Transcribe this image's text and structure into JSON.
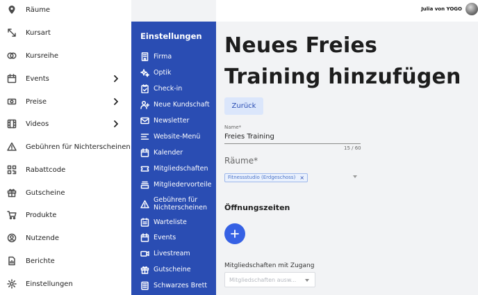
{
  "user": {
    "name": "Julia von YOGO"
  },
  "main_nav": {
    "items": [
      {
        "label": "Räume",
        "icon": "map-pin-icon",
        "has_submenu": false
      },
      {
        "label": "Kursart",
        "icon": "arrows-icon",
        "has_submenu": false
      },
      {
        "label": "Kursreihe",
        "icon": "circles-icon",
        "has_submenu": false
      },
      {
        "label": "Events",
        "icon": "calendar-icon",
        "has_submenu": true
      },
      {
        "label": "Preise",
        "icon": "cash-icon",
        "has_submenu": true
      },
      {
        "label": "Videos",
        "icon": "film-icon",
        "has_submenu": true
      },
      {
        "label": "Gebühren für Nichterscheinen",
        "icon": "warning-icon",
        "has_submenu": false
      },
      {
        "label": "Rabattcode",
        "icon": "qr-code-icon",
        "has_submenu": false
      },
      {
        "label": "Gutscheine",
        "icon": "gift-icon",
        "has_submenu": false
      },
      {
        "label": "Produkte",
        "icon": "cart-icon",
        "has_submenu": false
      },
      {
        "label": "Nutzende",
        "icon": "user-circle-icon",
        "has_submenu": false
      },
      {
        "label": "Berichte",
        "icon": "report-icon",
        "has_submenu": false
      },
      {
        "label": "Einstellungen",
        "icon": "gear-icon",
        "has_submenu": false
      }
    ]
  },
  "settings": {
    "title": "Einstellungen",
    "items": [
      {
        "label": "Firma",
        "icon": "building-icon"
      },
      {
        "label": "Optik",
        "icon": "sparkle-icon"
      },
      {
        "label": "Check-in",
        "icon": "clipboard-check-icon"
      },
      {
        "label": "Neue Kundschaft",
        "icon": "user-plus-icon"
      },
      {
        "label": "Newsletter",
        "icon": "mail-icon"
      },
      {
        "label": "Website-Menü",
        "icon": "menu-lines-icon"
      },
      {
        "label": "Kalender",
        "icon": "calendar-icon"
      },
      {
        "label": "Mitgliedschaften",
        "icon": "ticket-icon"
      },
      {
        "label": "Mitgliedervorteile",
        "icon": "stack-icon"
      },
      {
        "label": "Gebühren für",
        "label2": "Nichterscheinen",
        "icon": "warning-icon"
      },
      {
        "label": "Warteliste",
        "icon": "list-calendar-icon"
      },
      {
        "label": "Events",
        "icon": "calendar-icon"
      },
      {
        "label": "Livestream",
        "icon": "video-icon"
      },
      {
        "label": "Gutscheine",
        "icon": "gift-icon"
      },
      {
        "label": "Schwarzes Brett",
        "icon": "board-icon"
      }
    ]
  },
  "form": {
    "title": "Neues Freies Training hinzufügen",
    "back_label": "Zurück",
    "name_label": "Name*",
    "name_value": "Freies Training",
    "name_counter": "15 / 60",
    "rooms_label": "Räume*",
    "rooms_selected": [
      "Fitnessstudio (Erdgeschoss)"
    ],
    "chip_remove": "×",
    "opening_hours_title": "Öffnungszeiten",
    "membership_label": "Mitgliedschaften mit Zugang",
    "membership_placeholder": "Mitgliedschaften ausw..."
  },
  "colors": {
    "settings_panel": "#2a4db3",
    "accent": "#3661e4",
    "back_button_bg": "#dbe6fb"
  }
}
